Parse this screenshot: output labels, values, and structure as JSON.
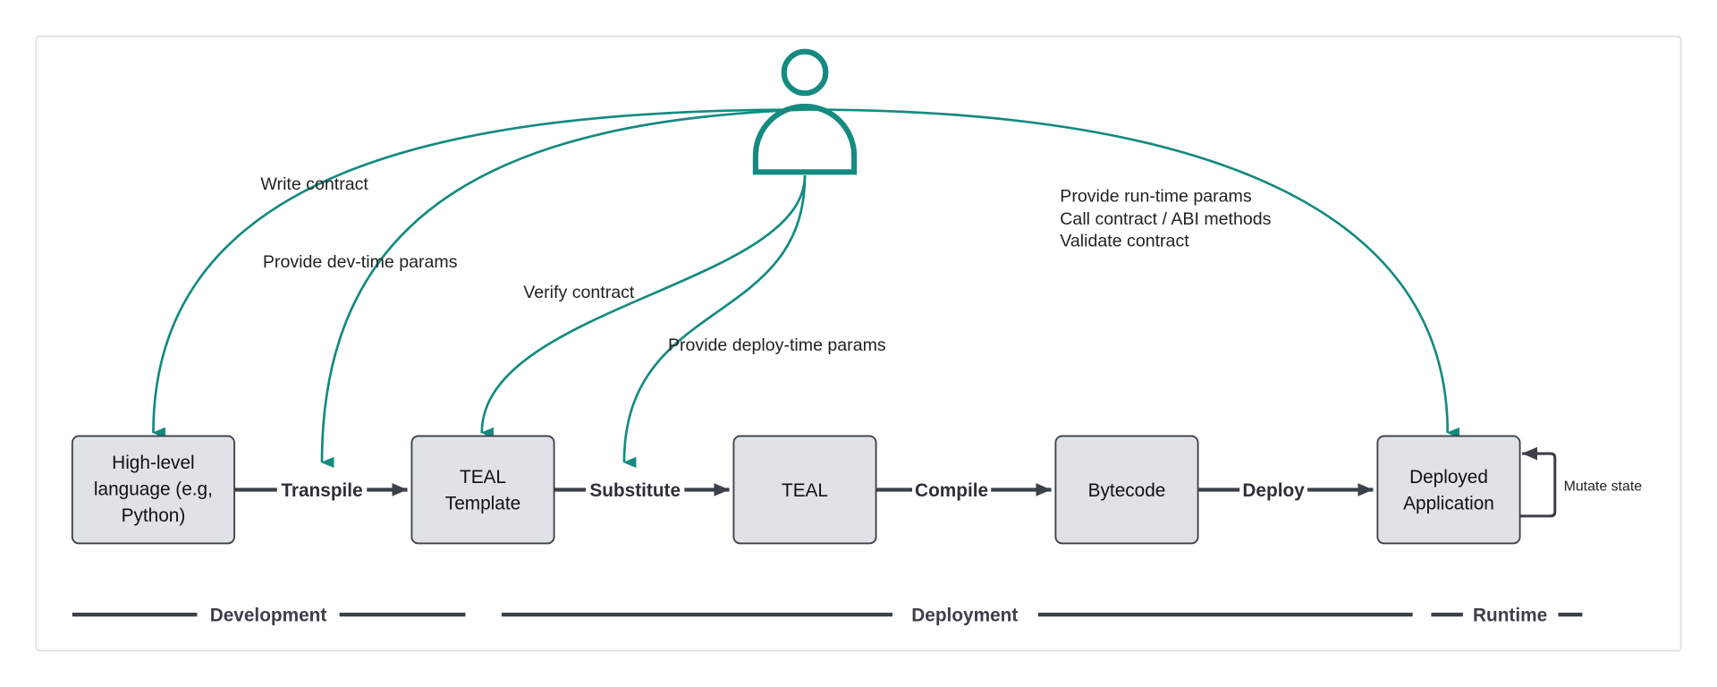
{
  "colors": {
    "accent": "#148a80",
    "box_fill": "#dfe2e6",
    "line": "#3c4048"
  },
  "actor": {
    "icon": "user-icon"
  },
  "actor_edges": {
    "write": "Write contract",
    "dev": "Provide dev-time params",
    "verify": "Verify contract",
    "deploy_params": "Provide deploy-time params",
    "runtime": [
      "Provide run-time params",
      "Call contract / ABI methods",
      "Validate contract"
    ]
  },
  "nodes": [
    {
      "lines": [
        "High-level",
        "language (e.g,",
        "Python)"
      ]
    },
    {
      "lines": [
        "TEAL",
        "Template"
      ]
    },
    {
      "lines": [
        "TEAL"
      ]
    },
    {
      "lines": [
        "Bytecode"
      ]
    },
    {
      "lines": [
        "Deployed",
        "Application"
      ]
    }
  ],
  "edges": [
    "Transpile",
    "Substitute",
    "Compile",
    "Deploy"
  ],
  "self_loop": "Mutate state",
  "phases": [
    "Development",
    "Deployment",
    "Runtime"
  ]
}
